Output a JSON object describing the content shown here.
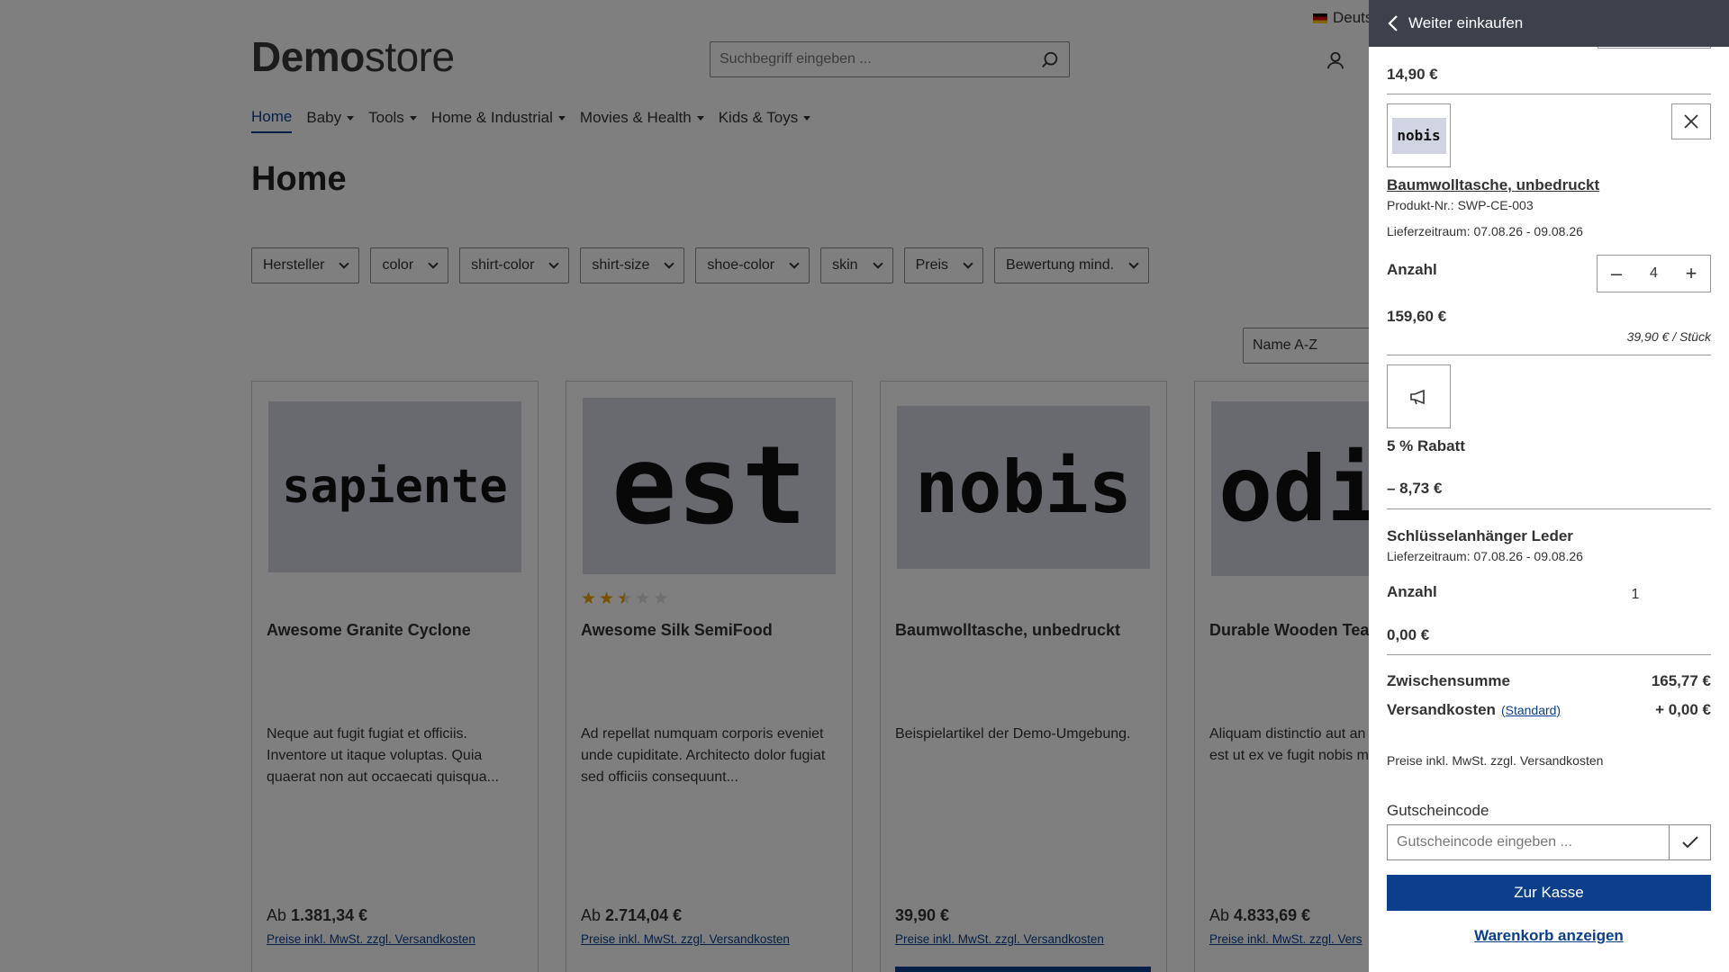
{
  "header": {
    "language": "Deutsch",
    "logo_bold": "Demo",
    "logo_light": "store",
    "search_placeholder": "Suchbegriff eingeben ..."
  },
  "nav": [
    {
      "label": "Home",
      "active": true,
      "dropdown": false
    },
    {
      "label": "Baby",
      "dropdown": true
    },
    {
      "label": "Tools",
      "dropdown": true
    },
    {
      "label": "Home & Industrial",
      "dropdown": true
    },
    {
      "label": "Movies & Health",
      "dropdown": true
    },
    {
      "label": "Kids & Toys",
      "dropdown": true
    }
  ],
  "page_title": "Home",
  "filters": [
    "Hersteller",
    "color",
    "shirt-color",
    "shirt-size",
    "shoe-color",
    "skin",
    "Preis",
    "Bewertung mind."
  ],
  "sort_label": "Name A-Z",
  "products": [
    {
      "image_text": "sapiente",
      "name": "Awesome Granite Cyclone",
      "description": "Neque aut fugit fugiat et officiis. Inventore ut itaque voluptas. Quia quaerat non aut occaecati quisqua...",
      "price_prefix": "Ab",
      "price": "1.381,34 €",
      "vat_note": "Preise inkl. MwSt. zzgl. Versandkosten",
      "rating": 0
    },
    {
      "image_text": "est",
      "name": "Awesome Silk SemiFood",
      "description": "Ad repellat numquam corporis eveniet unde cupiditate. Architecto dolor fugiat sed officiis consequunt...",
      "price_prefix": "Ab",
      "price": "2.714,04 €",
      "vat_note": "Preise inkl. MwSt. zzgl. Versandkosten",
      "rating": 2.5
    },
    {
      "image_text": "nobis",
      "name": "Baumwolltasche, unbedruckt",
      "description": "Beispielartikel der Demo-Umgebung.",
      "price_prefix": "",
      "price": "39,90 €",
      "vat_note": "Preise inkl. MwSt. zzgl. Versandkosten",
      "rating": 0
    },
    {
      "image_text": "odi",
      "name": "Durable Wooden Tea",
      "description": "Aliquam distinctio aut an Voluptatibus est ut ex ve fugit nobis maxime accu",
      "price_prefix": "Ab",
      "price": "4.833,69 €",
      "vat_note": "Preise inkl. MwSt. zzgl. Vers",
      "rating": 0
    }
  ],
  "cart": {
    "back_label": "Weiter einkaufen",
    "top_price": "14,90 €",
    "item1": {
      "thumb_text": "nobis",
      "name": "Baumwolltasche, unbedruckt",
      "product_no": "Produkt-Nr.: SWP-CE-003",
      "delivery": "Lieferzeitraum: 07.08.26 - 09.08.26",
      "qty_label": "Anzahl",
      "qty": "4",
      "total": "159,60 €",
      "unit_price": "39,90 € / Stück"
    },
    "discount": {
      "label": "5 % Rabatt",
      "amount": "– 8,73 €"
    },
    "item2": {
      "name": "Schlüsselanhänger Leder",
      "delivery": "Lieferzeitraum: 07.08.26 - 09.08.26",
      "qty_label": "Anzahl",
      "qty": "1",
      "total": "0,00 €"
    },
    "subtotal_label": "Zwischensumme",
    "subtotal": "165,77 €",
    "shipping_label": "Versandkosten",
    "shipping_method": "(Standard)",
    "shipping": "+ 0,00 €",
    "vat_note": "Preise inkl. MwSt. zzgl. Versandkosten",
    "coupon_label": "Gutscheincode",
    "coupon_placeholder": "Gutscheincode eingeben ...",
    "checkout_label": "Zur Kasse",
    "show_cart_label": "Warenkorb anzeigen"
  },
  "colors": {
    "primary": "#0b3f8c",
    "header_dark": "#3d414c",
    "star": "#e8a500",
    "placeholder_bg": "#d1d4e1"
  }
}
